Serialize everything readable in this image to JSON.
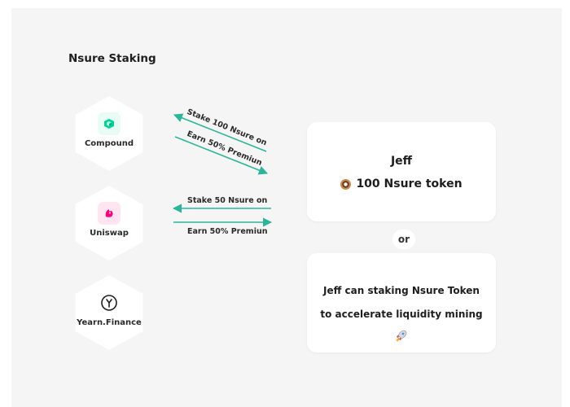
{
  "title": "Nsure Staking",
  "protocols": [
    {
      "name": "Compound",
      "icon": "compound-icon",
      "color": "#00d395"
    },
    {
      "name": "Uniswap",
      "icon": "uniswap-icon",
      "color": "#ff007a"
    },
    {
      "name": "Yearn.Finance",
      "icon": "yearn-icon",
      "color": "#1e1e1e"
    }
  ],
  "flows": {
    "compound": {
      "stake": "Stake 100 Nsure on",
      "earn": "Earn 50% Premiun"
    },
    "uniswap": {
      "stake": "Stake 50 Nsure on",
      "earn": "Earn 50% Premiun"
    }
  },
  "arrow_color": "#2bb59a",
  "user_card": {
    "name": "Jeff",
    "token_icon": "donut-icon",
    "tokens": "100 Nsure token"
  },
  "separator": "or",
  "alt_card": {
    "line1": "Jeff can staking Nsure Token",
    "line2": "to accelerate liquidity mining",
    "icon": "rocket-icon"
  }
}
